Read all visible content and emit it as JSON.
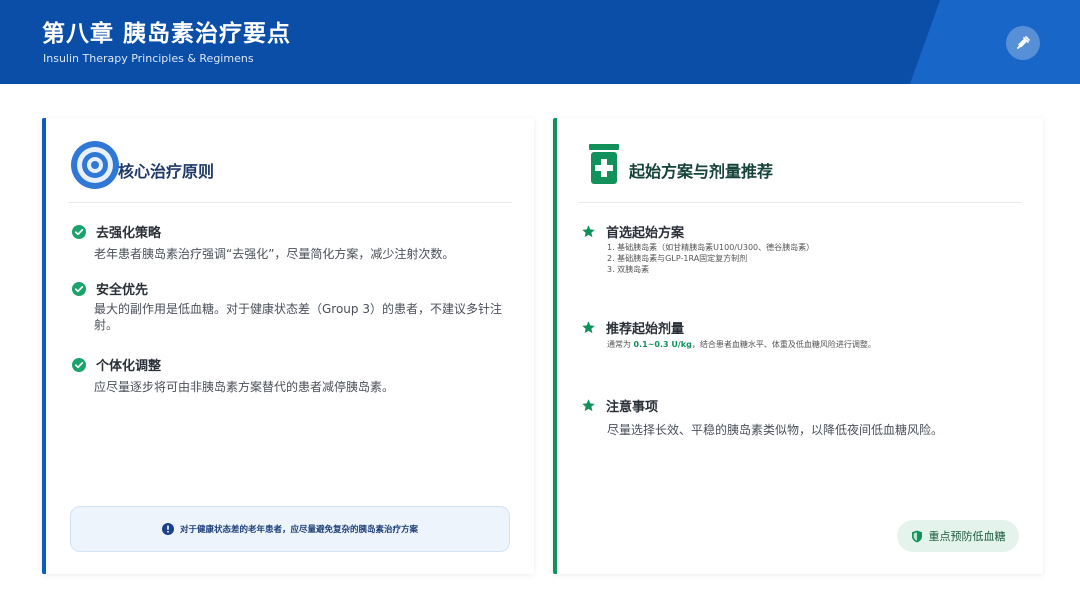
{
  "header": {
    "title": "第八章 胰岛素治疗要点",
    "subtitle": "Insulin Therapy Principles & Regimens",
    "badge_icon": "syringe-icon"
  },
  "left_card": {
    "title": "核心治疗原则",
    "icon": "target-icon",
    "accent": "#0e5bc0",
    "items": [
      {
        "label": "去强化策略",
        "text": "老年患者胰岛素治疗强调“去强化”，尽量简化方案，减少注射次数。"
      },
      {
        "label": "安全优先",
        "text": "最大的副作用是低血糖。对于健康状态差（Group 3）的患者，不建议多针注射。"
      },
      {
        "label": "个体化调整",
        "text": "应尽量逐步将可由非胰岛素方案替代的患者减停胰岛素。"
      }
    ],
    "note": "对于健康状态差的老年患者，应尽量避免复杂的胰岛素治疗方案"
  },
  "right_card": {
    "title": "起始方案与剂量推荐",
    "icon": "medicine-bottle-icon",
    "accent": "#12925a",
    "items": [
      {
        "label": "首选起始方案",
        "lines": [
          "1. 基础胰岛素（如甘精胰岛素U100/U300、德谷胰岛素）",
          "2. 基础胰岛素与GLP-1RA固定复方制剂",
          "3. 双胰岛素"
        ]
      },
      {
        "label": "推荐起始剂量",
        "prefix": "通常为 ",
        "highlight": "0.1~0.3 U/kg",
        "suffix": "，结合患者血糖水平、体重及低血糖风险进行调整。"
      },
      {
        "label": "注意事项",
        "text": "尽量选择长效、平稳的胰岛素类似物，以降低夜间低血糖风险。"
      }
    ],
    "pill": "重点预防低血糖"
  }
}
